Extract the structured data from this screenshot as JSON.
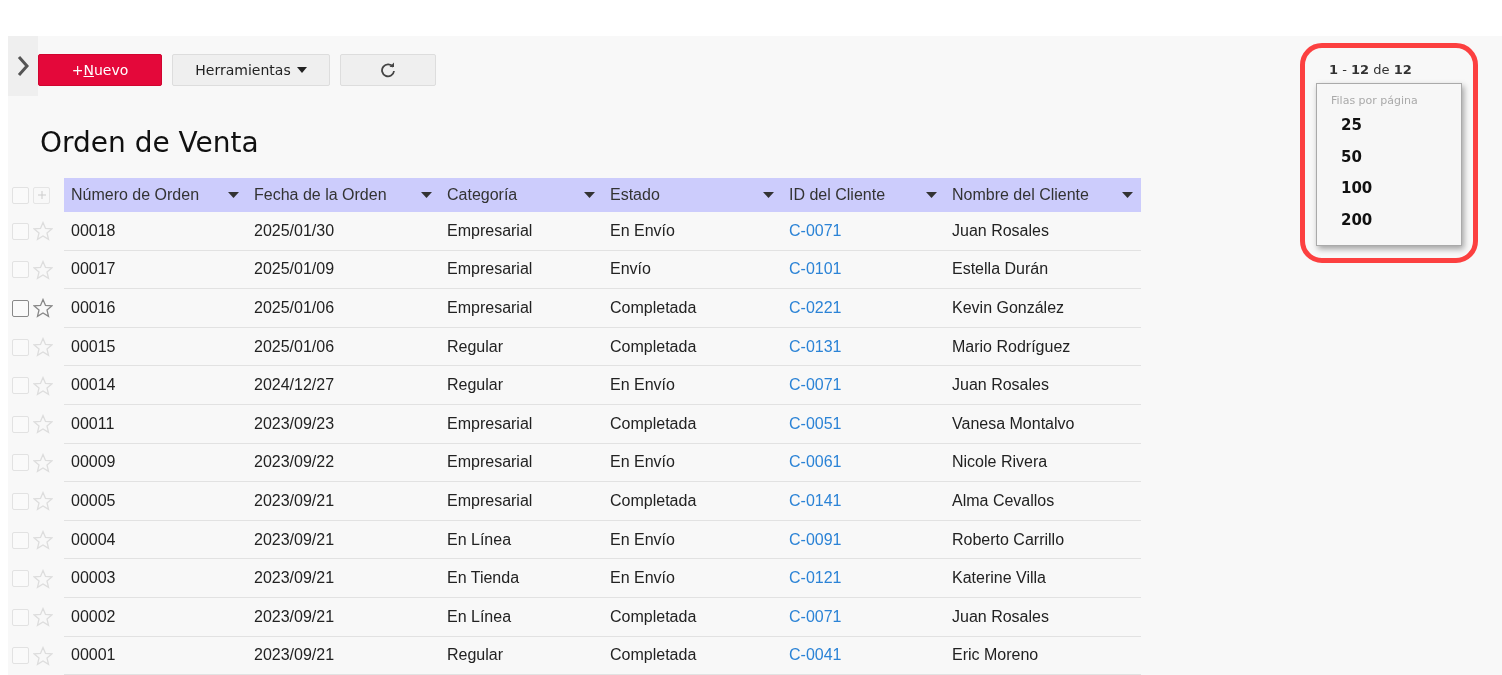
{
  "toolbar": {
    "new_button": "+Nuevo",
    "new_button_hotkey_underlined": true,
    "tools_button": "Herramientas"
  },
  "title": "Orden de Venta",
  "pager": {
    "range": "**1** - **12** de **12**",
    "highlighted": true,
    "menu": {
      "heading": "Filas por página",
      "options": [
        "25",
        "50",
        "100",
        "200"
      ]
    }
  },
  "table": {
    "select_all_checked": false,
    "columns": [
      "Número de Orden",
      "Fecha de la Orden",
      "Categoría",
      "Estado",
      "ID del Cliente",
      "Nombre del Cliente"
    ],
    "rows": [
      {
        "cells": [
          "00018",
          "2025/01/30",
          "Empresarial",
          "En Envío",
          "C-0071",
          "Juan Rosales"
        ],
        "hovered": false,
        "checked": false
      },
      {
        "cells": [
          "00017",
          "2025/01/09",
          "Empresarial",
          "Envío",
          "C-0101",
          "Estella Durán"
        ],
        "hovered": false,
        "checked": false
      },
      {
        "cells": [
          "00016",
          "2025/01/06",
          "Empresarial",
          "Completada",
          "C-0221",
          "Kevin González"
        ],
        "hovered": true,
        "checked": false
      },
      {
        "cells": [
          "00015",
          "2025/01/06",
          "Regular",
          "Completada",
          "C-0131",
          "Mario Rodríguez"
        ],
        "hovered": false,
        "checked": false
      },
      {
        "cells": [
          "00014",
          "2024/12/27",
          "Regular",
          "En Envío",
          "C-0071",
          "Juan Rosales"
        ],
        "hovered": false,
        "checked": false
      },
      {
        "cells": [
          "00011",
          "2023/09/23",
          "Empresarial",
          "Completada",
          "C-0051",
          "Vanesa Montalvo"
        ],
        "hovered": false,
        "checked": false
      },
      {
        "cells": [
          "00009",
          "2023/09/22",
          "Empresarial",
          "En Envío",
          "C-0061",
          "Nicole Rivera"
        ],
        "hovered": false,
        "checked": false
      },
      {
        "cells": [
          "00005",
          "2023/09/21",
          "Empresarial",
          "Completada",
          "C-0141",
          "Alma Cevallos"
        ],
        "hovered": false,
        "checked": false
      },
      {
        "cells": [
          "00004",
          "2023/09/21",
          "En Línea",
          "En Envío",
          "C-0091",
          "Roberto Carrillo"
        ],
        "hovered": false,
        "checked": false
      },
      {
        "cells": [
          "00003",
          "2023/09/21",
          "En Tienda",
          "En Envío",
          "C-0121",
          "Katerine Villa"
        ],
        "hovered": false,
        "checked": false
      },
      {
        "cells": [
          "00002",
          "2023/09/21",
          "En Línea",
          "Completada",
          "C-0071",
          "Juan Rosales"
        ],
        "hovered": false,
        "checked": false
      },
      {
        "cells": [
          "00001",
          "2023/09/21",
          "Regular",
          "Completada",
          "C-0041",
          "Eric Moreno"
        ],
        "hovered": false,
        "checked": false
      }
    ]
  }
}
